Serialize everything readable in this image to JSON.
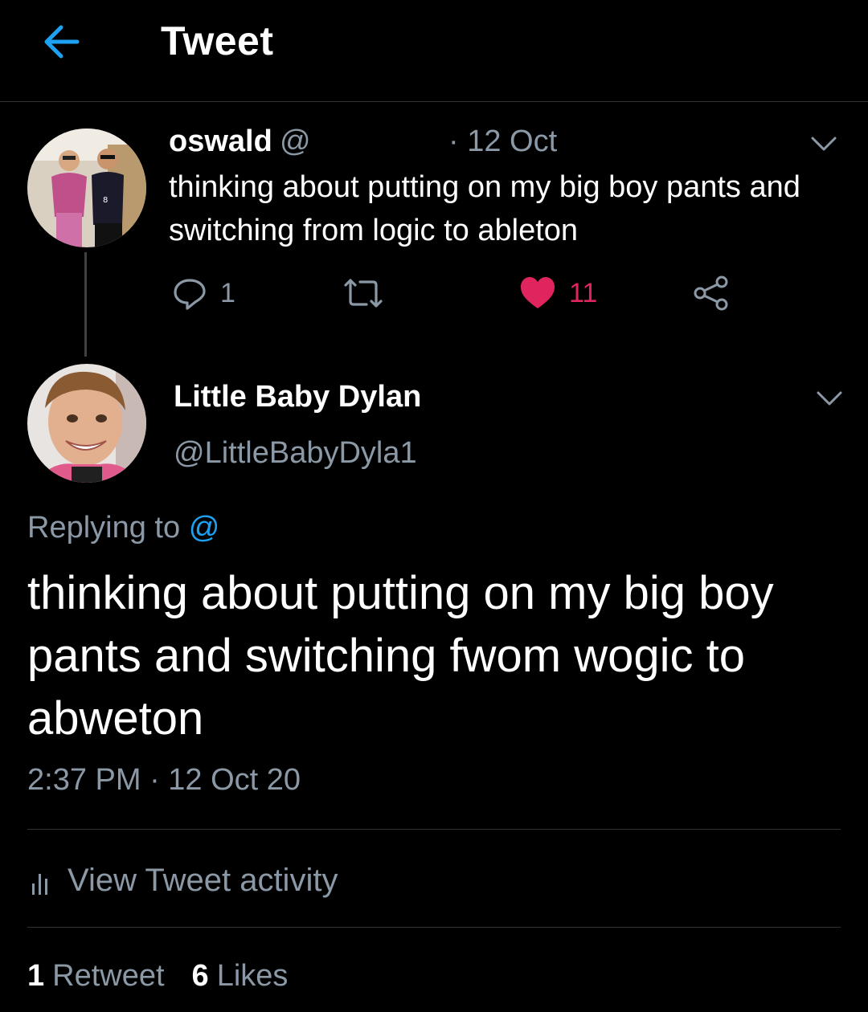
{
  "header": {
    "title": "Tweet",
    "back_icon": "arrow-left-icon",
    "accent": "#1da1f2"
  },
  "tweet": {
    "author_name": "oswald",
    "author_handle": "@",
    "time_sep": "· 12 Oct",
    "text": "thinking about putting on my big boy pants and switching from logic to ableton",
    "actions": {
      "reply_count": "1",
      "retweet_count": "",
      "like_count": "11",
      "like_color": "#e0245e"
    }
  },
  "reply": {
    "author_name": "Little Baby Dylan",
    "author_handle": "@LittleBabyDyla1",
    "replying_label": "Replying to",
    "replying_mention": "@",
    "text": "thinking about putting on my big boy pants and switching fwom wogic to abweton",
    "meta": "2:37 PM · 12 Oct 20",
    "activity_label": "View Tweet activity",
    "stats": {
      "retweet_count": "1",
      "retweet_label": "Retweet",
      "like_count": "6",
      "like_label": "Likes"
    }
  }
}
